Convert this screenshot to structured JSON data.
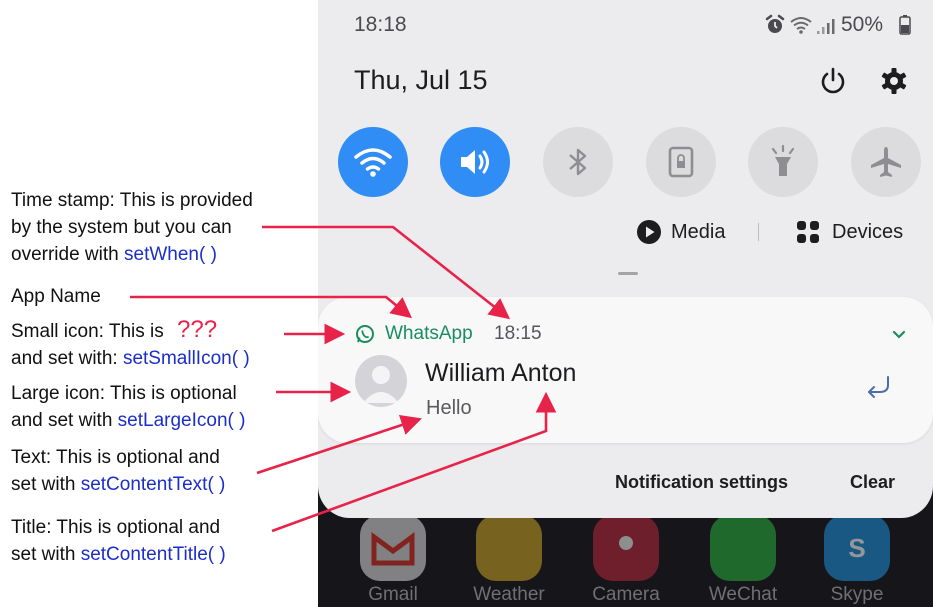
{
  "status_bar": {
    "time": "18:18",
    "battery": "50%"
  },
  "header": {
    "date": "Thu, Jul 15"
  },
  "quick_settings": [
    {
      "name": "wifi",
      "on": true
    },
    {
      "name": "sound",
      "on": true
    },
    {
      "name": "bluetooth",
      "on": false
    },
    {
      "name": "rotation-lock",
      "on": false
    },
    {
      "name": "flashlight",
      "on": false
    },
    {
      "name": "airplane",
      "on": false
    }
  ],
  "media_label": "Media",
  "devices_label": "Devices",
  "notification": {
    "app_name": "WhatsApp",
    "time": "18:15",
    "title": "William Anton",
    "text": "Hello"
  },
  "footer": {
    "settings_label": "Notification settings",
    "clear_label": "Clear"
  },
  "home_apps": [
    "Gmail",
    "Weather",
    "Camera",
    "WeChat",
    "Skype"
  ],
  "annotations": {
    "timestamp": {
      "lines": [
        "Time stamp: This is provided",
        "by the system but you can"
      ],
      "prefix": "override with ",
      "code": "setWhen( )"
    },
    "app_name": {
      "text": "App Name"
    },
    "small_icon": {
      "prefix": "Small icon: This is ",
      "marks": "???",
      "line2": "and set with: ",
      "code": "setSmallIcon( )"
    },
    "large_icon": {
      "line1": "Large icon: This is optional",
      "line2": "and set with ",
      "code": "setLargeIcon( )"
    },
    "text": {
      "line1": "Text: This is optional and",
      "line2": "set with ",
      "code": "setContentText( )"
    },
    "title": {
      "line1": "Title: This is optional and",
      "line2": "set with ",
      "code": "setContentTitle( )"
    }
  },
  "colors": {
    "accent": "#2f8df5",
    "arrow": "#e8234a",
    "code": "#1b2ec9",
    "whatsapp": "#1a8d5f"
  }
}
